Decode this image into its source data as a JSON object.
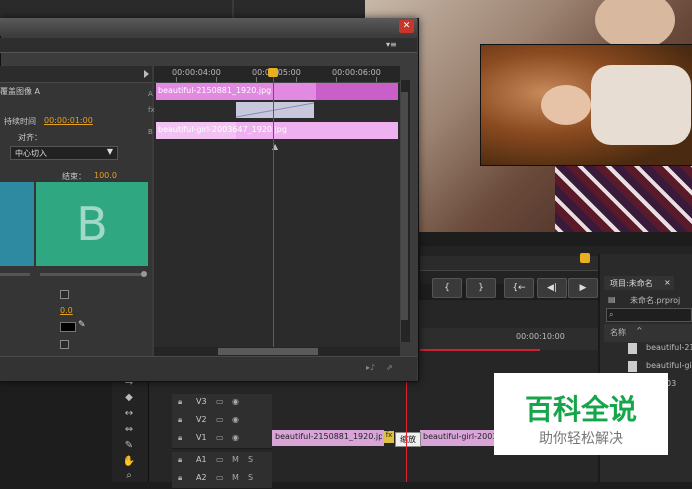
{
  "dialog": {
    "title": "",
    "overlay_label": "覆盖图像 A",
    "duration_label": "持续时间",
    "duration_value": "00:00:01:00",
    "align_label": "对齐：",
    "align_value": "中心切入",
    "end_label": "结束：",
    "end_value": "100.0",
    "thumb_letter": "B",
    "border_value": "0.0",
    "row_labels": [
      "A",
      "fx",
      "B"
    ]
  },
  "dialog_timeline": {
    "ticks": [
      "00:00:04:00",
      "00:00:05:00",
      "00:00:06:00"
    ],
    "clip_a_name": "beautiful-2150881_1920.jpg",
    "clip_b_name": "beautiful-girl-2003647_1920.jpg"
  },
  "monitor": {
    "controls": [
      "{",
      "}",
      "{←",
      "◀|",
      "▶"
    ]
  },
  "timeline": {
    "ruler_time": "00:00:10:00",
    "tracks": [
      {
        "name": "V3"
      },
      {
        "name": "V2"
      },
      {
        "name": "V1"
      },
      {
        "name": "A1",
        "m": "M",
        "s": "S"
      },
      {
        "name": "A2",
        "m": "M",
        "s": "S"
      }
    ],
    "v1_clip1": "beautiful-2150881_1920.jpg",
    "v1_clip2": "beautiful-girl-2003",
    "fx_badge": "fx",
    "tooltip": "缩放"
  },
  "project": {
    "tab": "项目:未命名",
    "tab_close": "×",
    "file": "未命名.prproj",
    "search_placeholder": "",
    "col_name": "名称",
    "items": [
      "beautiful-21",
      "beautiful-gir",
      "03"
    ]
  },
  "watermark": {
    "main": "百科全说",
    "sub": "助你轻松解决"
  },
  "colors": {
    "clip_pink": "#e28ae2",
    "playhead": "#dd2233",
    "thumb_a": "#2d8aa0",
    "thumb_b": "#2fa882",
    "value_orange": "#e8a020",
    "close_red": "#c8352a",
    "watermark_green": "#16a54a"
  }
}
